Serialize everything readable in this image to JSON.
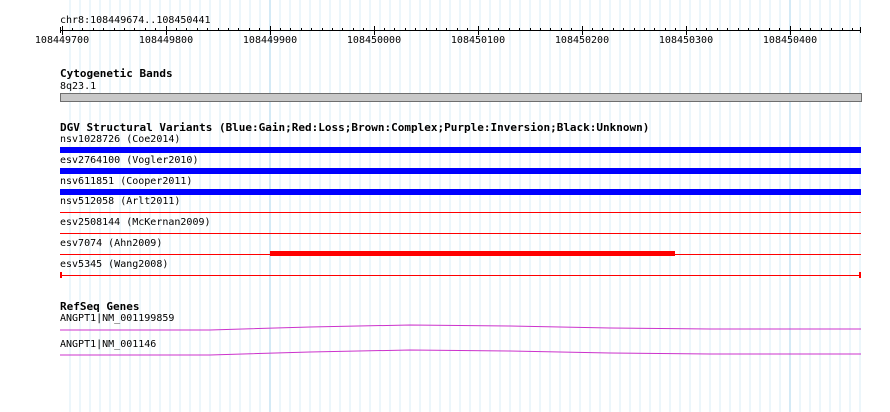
{
  "ruler": {
    "location": "chr8:108449674..108450441",
    "start": 108449674,
    "end": 108450441,
    "ticks": [
      "108449700",
      "108449800",
      "108449900",
      "108450000",
      "108450100",
      "108450200",
      "108450300",
      "108450400"
    ]
  },
  "cytoband": {
    "title": "Cytogenetic Bands",
    "band": "8q23.1",
    "color": "#c8c8c8"
  },
  "dgv": {
    "title": "DGV Structural Variants (Blue:Gain;Red:Loss;Brown:Complex;Purple:Inversion;Black:Unknown)",
    "colors": {
      "gain": "#0000ff",
      "loss": "#ff0000"
    },
    "variants": [
      {
        "label": "nsv1028726 (Coe2014)",
        "type": "gain"
      },
      {
        "label": "esv2764100 (Vogler2010)",
        "type": "gain"
      },
      {
        "label": "nsv611851 (Cooper2011)",
        "type": "gain"
      },
      {
        "label": "nsv512058 (Arlt2011)",
        "type": "loss"
      },
      {
        "label": "esv2508144 (McKernan2009)",
        "type": "loss"
      },
      {
        "label": "esv7074 (Ahn2009)",
        "type": "loss",
        "highlight": true
      },
      {
        "label": "esv5345 (Wang2008)",
        "type": "loss",
        "ends": true
      }
    ]
  },
  "refseq": {
    "title": "RefSeq Genes",
    "color": "#cc33cc",
    "genes": [
      {
        "label": "ANGPT1|NM_001199859"
      },
      {
        "label": "ANGPT1|NM_001146"
      }
    ]
  }
}
